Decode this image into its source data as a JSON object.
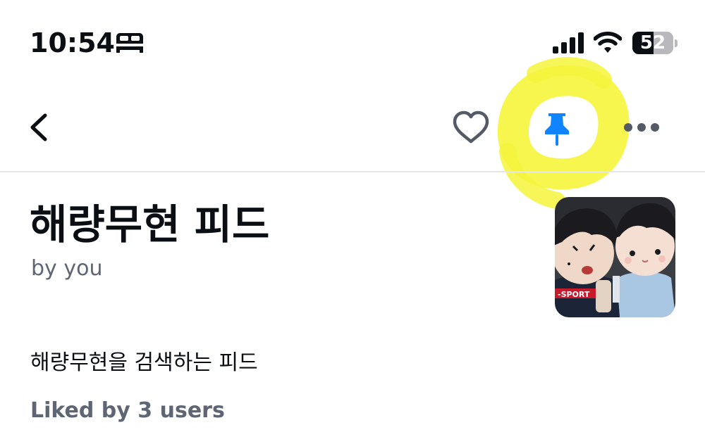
{
  "status_bar": {
    "time": "10:54",
    "battery_level": "52",
    "battery_fraction": 0.52,
    "icons": [
      "bed-icon",
      "cellular-signal-icon",
      "wifi-icon",
      "battery-icon"
    ]
  },
  "nav": {
    "icons": [
      "back-chevron-icon",
      "heart-icon",
      "pin-icon",
      "more-icon"
    ],
    "pin_color": "#1083fe",
    "highlight_color": "#f5f53c"
  },
  "feed": {
    "title": "해량무현 피드",
    "byline": "by you",
    "description": "해량무현을 검색하는 피드",
    "likes": "Liked by 3 users"
  },
  "colors": {
    "text_primary": "#0b0f14",
    "text_secondary": "#5f6673",
    "icon_gray": "#545b67",
    "accent": "#1083fe"
  }
}
